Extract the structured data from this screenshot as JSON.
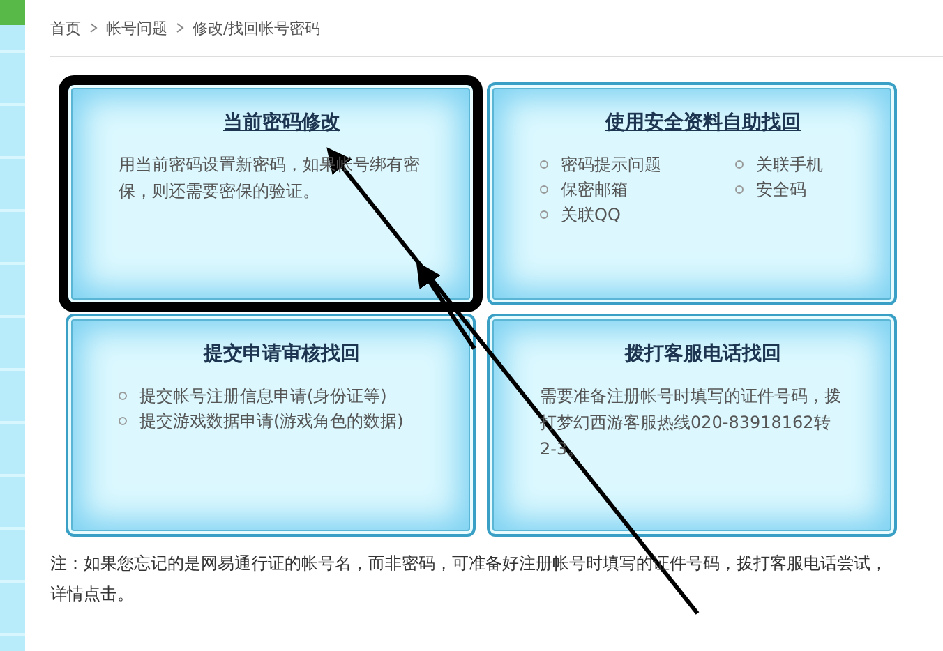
{
  "breadcrumb": [
    "首页",
    "帐号问题",
    "修改/找回帐号密码"
  ],
  "cards": [
    {
      "title": "当前密码修改",
      "link": true,
      "highlighted": true,
      "kind": "text",
      "text": "用当前密码设置新密码，如果帐号绑有密保，则还需要密保的验证。"
    },
    {
      "title": "使用安全资料自助找回",
      "link": true,
      "highlighted": false,
      "kind": "columns",
      "items": [
        "密码提示问题",
        "保密邮箱",
        "关联QQ",
        "关联手机",
        "安全码"
      ]
    },
    {
      "title": "提交申请审核找回",
      "link": false,
      "highlighted": false,
      "kind": "list",
      "items": [
        "提交帐号注册信息申请(身份证等)",
        "提交游戏数据申请(游戏角色的数据)"
      ]
    },
    {
      "title": "拨打客服电话找回",
      "link": false,
      "highlighted": false,
      "kind": "text",
      "text": "需要准备注册帐号时填写的证件号码，拨打梦幻西游客服热线020-83918162转2-3。"
    }
  ],
  "note": "注：如果您忘记的是网易通行证的帐号名，而非密码，可准备好注册帐号时填写的证件号码，拨打客服电话尝试，详情点击。"
}
